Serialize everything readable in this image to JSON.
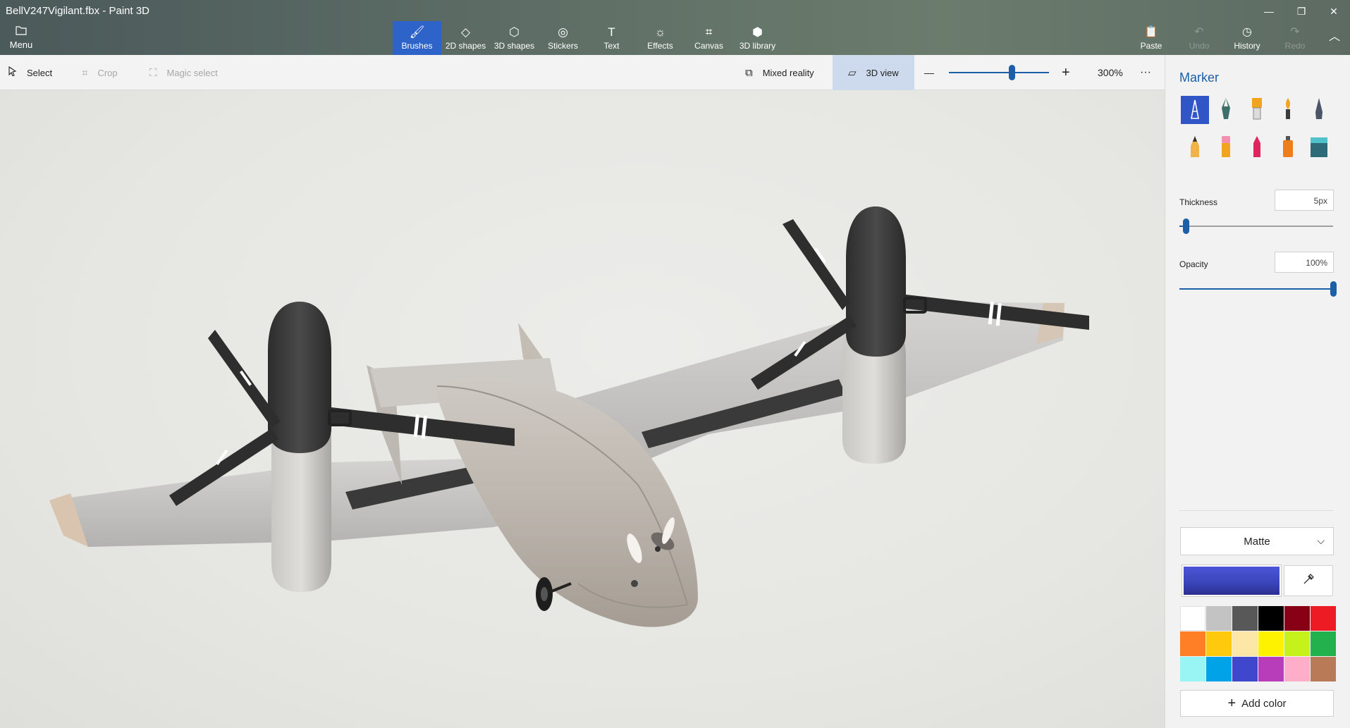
{
  "window": {
    "title": "BellV247Vigilant.fbx - Paint 3D",
    "minimize": "—",
    "restore": "❐",
    "close": "✕"
  },
  "menu": {
    "label": "Menu",
    "icon": "folder-icon"
  },
  "tools": [
    {
      "label": "Brushes",
      "icon": "brush-icon",
      "glyph": "🖌",
      "active": true
    },
    {
      "label": "2D shapes",
      "icon": "2d-shapes-icon",
      "glyph": "◇"
    },
    {
      "label": "3D shapes",
      "icon": "3d-shapes-icon",
      "glyph": "⬡"
    },
    {
      "label": "Stickers",
      "icon": "stickers-icon",
      "glyph": "◎"
    },
    {
      "label": "Text",
      "icon": "text-icon",
      "glyph": "T"
    },
    {
      "label": "Effects",
      "icon": "effects-icon",
      "glyph": "☼"
    },
    {
      "label": "Canvas",
      "icon": "canvas-icon",
      "glyph": "⌗"
    },
    {
      "label": "3D library",
      "icon": "3d-library-icon",
      "glyph": "⬢"
    }
  ],
  "right_tools": {
    "paste": "Paste",
    "undo": "Undo",
    "history": "History",
    "redo": "Redo",
    "collapse": "︿"
  },
  "toolbar2": {
    "select": "Select",
    "crop": "Crop",
    "magic_select": "Magic select",
    "mixed_reality": "Mixed reality",
    "view3d": "3D view",
    "zoom_out": "—",
    "zoom_in": "+",
    "zoom": "300%",
    "more": "···",
    "zoom_level_fraction": 0.63
  },
  "panel": {
    "title": "Marker",
    "brushes": [
      {
        "name": "marker",
        "icon": "marker-brush-icon",
        "active": true
      },
      {
        "name": "calligraphy-pen",
        "icon": "calligraphy-pen-icon"
      },
      {
        "name": "oil-brush",
        "icon": "oil-brush-icon"
      },
      {
        "name": "watercolor",
        "icon": "watercolor-icon"
      },
      {
        "name": "pixel-pen",
        "icon": "pixel-pen-icon"
      },
      {
        "name": "pencil",
        "icon": "pencil-icon"
      },
      {
        "name": "eraser",
        "icon": "eraser-icon"
      },
      {
        "name": "crayon",
        "icon": "crayon-icon"
      },
      {
        "name": "spray-can",
        "icon": "spray-can-icon"
      },
      {
        "name": "fill",
        "icon": "fill-bucket-icon"
      }
    ],
    "thickness_label": "Thickness",
    "thickness_value": "5px",
    "thickness_fraction": 0.05,
    "opacity_label": "Opacity",
    "opacity_value": "100%",
    "opacity_fraction": 1.0,
    "finish": "Matte",
    "current_color": "#3a44b8",
    "palette": [
      "#ffffff",
      "#c3c3c3",
      "#585858",
      "#000000",
      "#880015",
      "#ed1c24",
      "#ff7f27",
      "#ffc90e",
      "#fde7a6",
      "#fff200",
      "#c4f21a",
      "#22b14c",
      "#99f4f4",
      "#00a2e8",
      "#3f48cc",
      "#b83dba",
      "#ffaec9",
      "#b97a57"
    ],
    "add_color": "Add color"
  },
  "accent": "#1c5fa8",
  "active_tool_color": "#2e63c9"
}
